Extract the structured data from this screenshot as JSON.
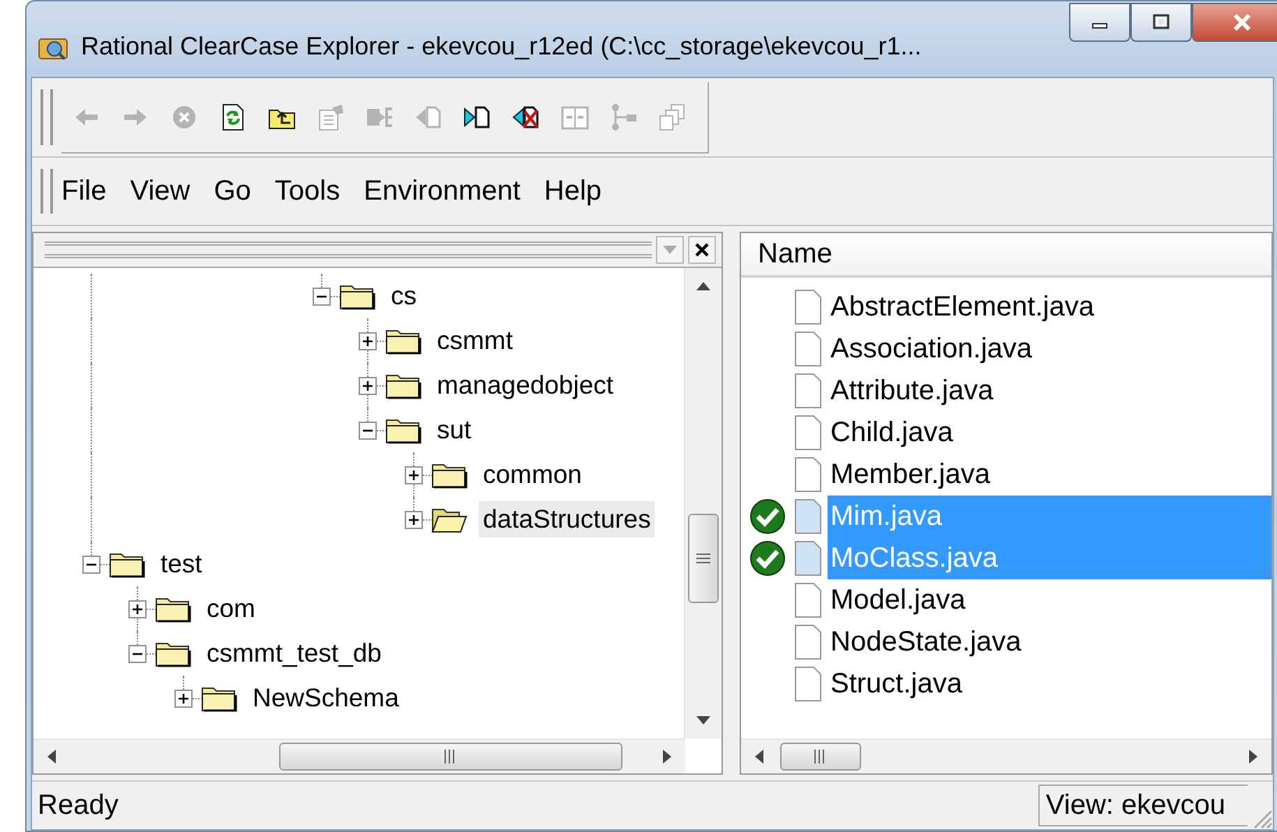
{
  "window": {
    "title": "Rational ClearCase Explorer - ekevcou_r12ed (C:\\cc_storage\\ekevcou_r1..."
  },
  "toolbar": [
    {
      "kind": "back",
      "disabled": true
    },
    {
      "kind": "forward",
      "disabled": true
    },
    {
      "kind": "stop",
      "disabled": true
    },
    {
      "kind": "refresh",
      "disabled": false
    },
    {
      "kind": "up",
      "disabled": false
    },
    {
      "kind": "properties",
      "disabled": true
    },
    {
      "kind": "checkout",
      "disabled": true
    },
    {
      "kind": "checkin",
      "disabled": true
    },
    {
      "kind": "compare",
      "disabled": false
    },
    {
      "kind": "undo",
      "disabled": false
    },
    {
      "kind": "merge",
      "disabled": true
    },
    {
      "kind": "tree",
      "disabled": true
    },
    {
      "kind": "copies",
      "disabled": true
    }
  ],
  "menu": [
    "File",
    "View",
    "Go",
    "Tools",
    "Environment",
    "Help"
  ],
  "tree": {
    "items": [
      {
        "children": [
          {
            "children": [
              {
                "children": [
                  {
                    "children": [
                      {
                        "children": [
                          {
                            "label": "cs",
                            "expanded": true,
                            "selected": false,
                            "children": [
                              {
                                "label": "csmmt",
                                "expanded": false,
                                "selected": false
                              },
                              {
                                "label": "managedobject",
                                "expanded": false,
                                "selected": false
                              },
                              {
                                "label": "sut",
                                "expanded": true,
                                "selected": false,
                                "children": [
                                  {
                                    "label": "common",
                                    "expanded": false,
                                    "selected": false
                                  },
                                  {
                                    "label": "dataStructures",
                                    "expanded": false,
                                    "selected": true
                                  }
                                ]
                              }
                            ]
                          }
                        ]
                      }
                    ]
                  }
                ]
              }
            ]
          }
        ]
      },
      {
        "label": "test",
        "expanded": true,
        "selected": false,
        "children": [
          {
            "label": "com",
            "expanded": false,
            "selected": false
          },
          {
            "label": "csmmt_test_db",
            "expanded": true,
            "selected": false,
            "children": [
              {
                "label": "NewSchema",
                "expanded": false,
                "selected": false
              }
            ]
          }
        ]
      }
    ]
  },
  "files": {
    "columns": [
      "Name"
    ],
    "rows": [
      {
        "name": "AbstractElement.java",
        "checked_out": false,
        "selected": false
      },
      {
        "name": "Association.java",
        "checked_out": false,
        "selected": false
      },
      {
        "name": "Attribute.java",
        "checked_out": false,
        "selected": false
      },
      {
        "name": "Child.java",
        "checked_out": false,
        "selected": false
      },
      {
        "name": "Member.java",
        "checked_out": false,
        "selected": false
      },
      {
        "name": "Mim.java",
        "checked_out": true,
        "selected": true
      },
      {
        "name": "MoClass.java",
        "checked_out": true,
        "selected": true
      },
      {
        "name": "Model.java",
        "checked_out": false,
        "selected": false
      },
      {
        "name": "NodeState.java",
        "checked_out": false,
        "selected": false
      },
      {
        "name": "Struct.java",
        "checked_out": false,
        "selected": false
      }
    ]
  },
  "status_bar": [
    "Ready",
    "View: ekevcou"
  ]
}
